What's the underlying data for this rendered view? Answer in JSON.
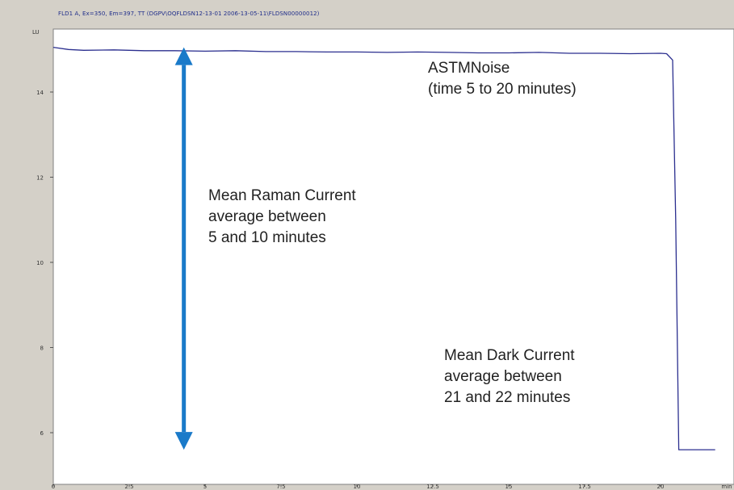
{
  "window": {
    "title": "FLD1 A, Ex=350, Em=397, TT (DGPV\\OQFLDSN12-13-01 2006-13-05-11\\FLDSN00000012)"
  },
  "chart_data": {
    "type": "line",
    "title": "",
    "xlabel": "",
    "ylabel": "",
    "y_unit_label": "LU",
    "x_unit_label": "min",
    "xlim": [
      0,
      21.8
    ],
    "ylim": [
      5.5,
      15.2
    ],
    "x_ticks": [
      0,
      2.5,
      5,
      7.5,
      10,
      12.5,
      15,
      17.5,
      20
    ],
    "x_tick_labels": [
      "0",
      "2.5",
      "5",
      "7.5",
      "10",
      "12.5",
      "15",
      "17.5",
      "20"
    ],
    "y_ticks": [
      6,
      8,
      10,
      12,
      14
    ],
    "y_tick_labels": [
      "6",
      "8",
      "10",
      "12",
      "14"
    ],
    "grid": false,
    "series": [
      {
        "color": "#2b2f8f",
        "x": [
          0,
          0.5,
          1.0,
          2.0,
          3.0,
          4.0,
          5.0,
          6.0,
          7.0,
          8.0,
          9.0,
          10.0,
          11.0,
          12.0,
          13.0,
          14.0,
          15.0,
          16.0,
          17.0,
          18.0,
          19.0,
          20.0,
          20.2,
          20.4,
          20.5,
          20.6,
          21.0,
          21.8
        ],
        "y": [
          15.05,
          15.0,
          14.98,
          14.99,
          14.97,
          14.97,
          14.96,
          14.97,
          14.95,
          14.95,
          14.94,
          14.94,
          14.93,
          14.94,
          14.93,
          14.92,
          14.92,
          14.93,
          14.91,
          14.91,
          14.9,
          14.91,
          14.9,
          14.75,
          11.0,
          5.6,
          5.6,
          5.6
        ]
      }
    ],
    "annotations": [
      {
        "lines": [
          "ASTMNoise",
          "(time 5 to 20 minutes)"
        ]
      },
      {
        "lines": [
          "Mean Raman Current",
          "average between",
          "5 and 10 minutes"
        ]
      },
      {
        "lines": [
          "Mean Dark Current",
          "average between",
          "21 and 22 minutes"
        ]
      }
    ],
    "arrow": {
      "x": 4.3,
      "y_from": 15.05,
      "y_to": 5.6,
      "color": "#1a7ac9"
    }
  }
}
